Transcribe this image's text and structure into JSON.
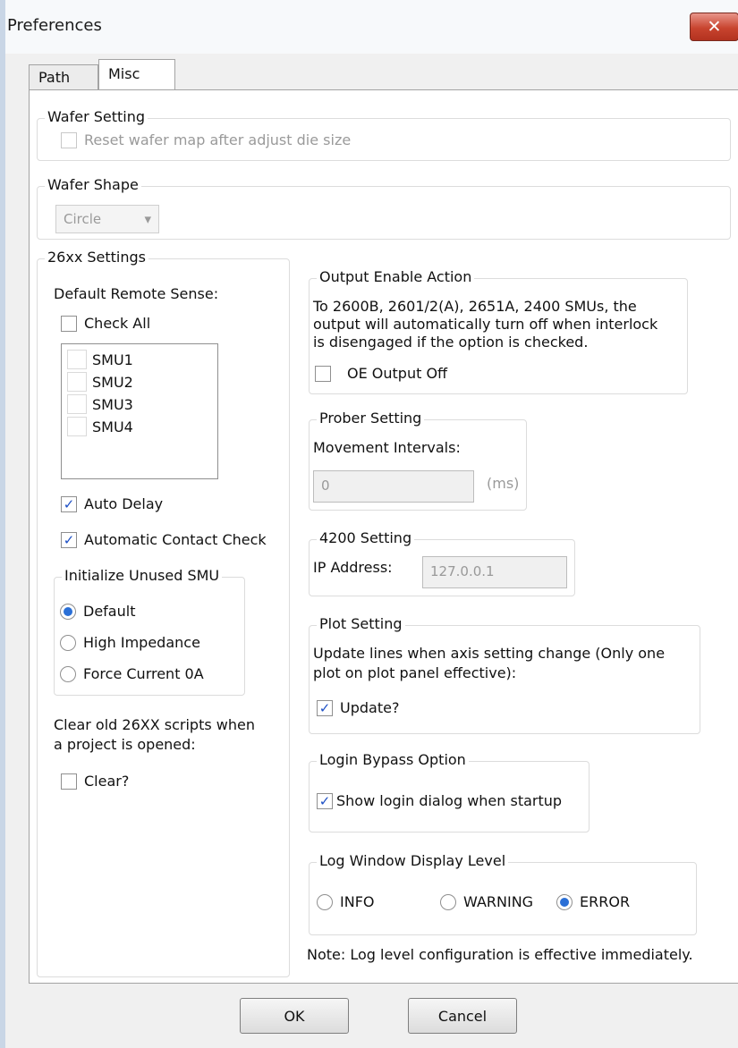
{
  "window": {
    "title": "Preferences",
    "close_label": "✕"
  },
  "tabs": [
    {
      "label": "Path"
    },
    {
      "label": "Misc"
    }
  ],
  "wafer_setting": {
    "legend": "Wafer Setting",
    "reset_label": "Reset wafer map after adjust die size",
    "reset_checked": false
  },
  "wafer_shape": {
    "legend": "Wafer Shape",
    "selected": "Circle"
  },
  "settings26xx": {
    "legend": "26xx Settings",
    "remote_sense_label": "Default Remote Sense:",
    "check_all_label": "Check All",
    "smus": [
      "SMU1",
      "SMU2",
      "SMU3",
      "SMU4"
    ],
    "auto_delay_label": "Auto Delay",
    "auto_delay_checked": true,
    "contact_check_label": "Automatic Contact Check",
    "contact_check_checked": true,
    "init_unused": {
      "legend": "Initialize Unused SMU",
      "options": [
        "Default",
        "High Impedance",
        "Force Current 0A"
      ],
      "selected": "Default"
    },
    "clear_scripts_text_1": "Clear old 26XX scripts when",
    "clear_scripts_text_2": "a project is opened:",
    "clear_label": "Clear?",
    "clear_checked": false
  },
  "output_enable": {
    "legend": "Output Enable Action",
    "desc_1": "To 2600B, 2601/2(A), 2651A, 2400 SMUs, the",
    "desc_2": "output will automatically turn off when interlock",
    "desc_3": "is disengaged if the option is checked.",
    "oe_label": "OE Output Off",
    "oe_checked": false
  },
  "prober": {
    "legend": "Prober Setting",
    "intervals_label": "Movement Intervals:",
    "intervals_value": "0",
    "unit": "(ms)"
  },
  "setting4200": {
    "legend": "4200 Setting",
    "ip_label": "IP Address:",
    "ip_value": "127.0.0.1"
  },
  "plot": {
    "legend": "Plot Setting",
    "desc_1": "Update lines when axis setting change (Only one",
    "desc_2": "plot on plot panel effective):",
    "update_label": "Update?",
    "update_checked": true
  },
  "login": {
    "legend": "Login Bypass Option",
    "show_label": "Show login dialog when startup",
    "show_checked": true
  },
  "log": {
    "legend": "Log Window Display Level",
    "options": [
      "INFO",
      "WARNING",
      "ERROR"
    ],
    "selected": "ERROR",
    "note": "Note: Log level configuration is effective immediately."
  },
  "buttons": {
    "ok": "OK",
    "cancel": "Cancel"
  },
  "colors": {
    "check": "#1d4fc5",
    "radio": "#2a6fd6",
    "close": "#c8442f"
  }
}
